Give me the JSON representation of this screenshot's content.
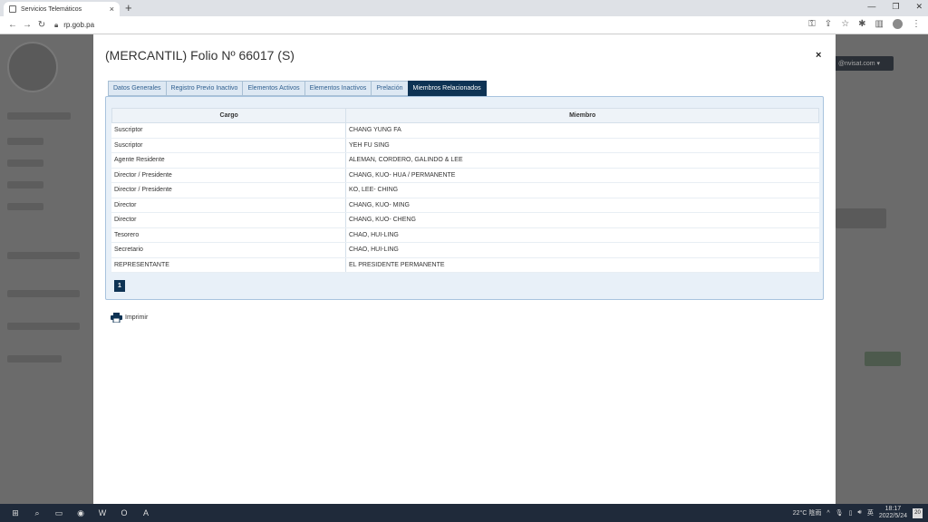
{
  "browser": {
    "tab_title": "Servicios Telemáticos",
    "tab_close": "×",
    "new_tab": "+",
    "url": "rp.gob.pa",
    "back": "←",
    "forward": "→",
    "reload": "↻"
  },
  "background_page": {
    "email_label": "@nvisat.com ▾"
  },
  "modal": {
    "title": "(MERCANTIL) Folio Nº 66017 (S)",
    "close": "×",
    "tabs": [
      {
        "label": "Datos Generales",
        "active": false
      },
      {
        "label": "Registro Previo Inactivo",
        "active": false
      },
      {
        "label": "Elementos Activos",
        "active": false
      },
      {
        "label": "Elementos Inactivos",
        "active": false
      },
      {
        "label": "Prelación",
        "active": false
      },
      {
        "label": "Miembros Relacionados",
        "active": true
      }
    ],
    "table": {
      "headers": {
        "cargo": "Cargo",
        "miembro": "Miembro"
      },
      "rows": [
        {
          "cargo": "Suscriptor",
          "miembro": "CHANG YUNG FA"
        },
        {
          "cargo": "Suscriptor",
          "miembro": "YEH FU SING"
        },
        {
          "cargo": "Agente Residente",
          "miembro": "ALEMAN, CORDERO, GALINDO & LEE"
        },
        {
          "cargo": "Director / Presidente",
          "miembro": "CHANG, KUO- HUA / PERMANENTE"
        },
        {
          "cargo": "Director / Presidente",
          "miembro": "KO, LEE- CHING"
        },
        {
          "cargo": "Director",
          "miembro": "CHANG, KUO- MING"
        },
        {
          "cargo": "Director",
          "miembro": "CHANG, KUO- CHENG"
        },
        {
          "cargo": "Tesorero",
          "miembro": "CHAO, HUI-LING"
        },
        {
          "cargo": "Secretario",
          "miembro": "CHAO, HUI-LING"
        },
        {
          "cargo": "REPRESENTANTE",
          "miembro": "EL PRESIDENTE PERMANENTE"
        }
      ]
    },
    "pager": {
      "current_page": "1"
    },
    "print_label": "Imprimir"
  },
  "taskbar": {
    "weather": "22°C 陰雨",
    "time": "18:17",
    "date": "2022/5/24",
    "notifications": "20"
  },
  "colors": {
    "active_tab": "#0e3354",
    "tab_bg": "#dde8f3",
    "panel_bg": "#e8f0f8",
    "overlay": "#6b6b6b"
  }
}
